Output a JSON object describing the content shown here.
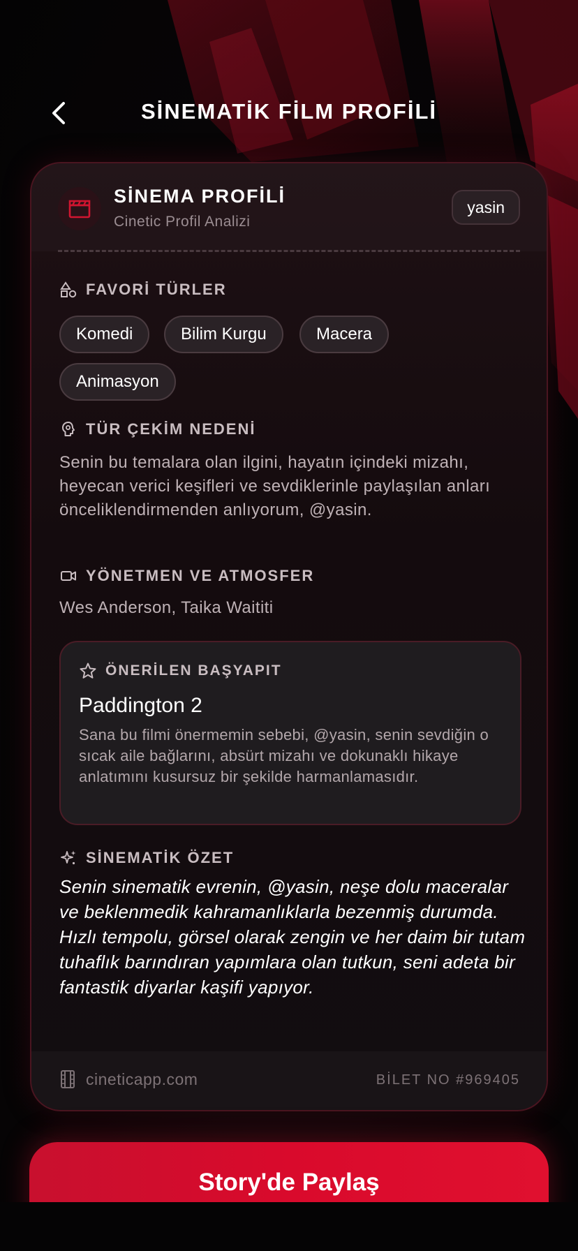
{
  "header": {
    "title": "SİNEMATİK FİLM PROFİLİ"
  },
  "card": {
    "title": "SİNEMA PROFİLİ",
    "subtitle": "Cinetic Profil Analizi",
    "username": "yasin"
  },
  "genres": {
    "heading": "FAVORİ TÜRLER",
    "items": [
      "Komedi",
      "Bilim Kurgu",
      "Macera",
      "Animasyon"
    ]
  },
  "reason": {
    "heading": "TÜR ÇEKİM NEDENİ",
    "text": "Senin bu temalara olan ilgini, hayatın içindeki mizahı, heyecan verici keşifleri ve sevdiklerinle paylaşılan anları önceliklendirmenden anlıyorum, @yasin."
  },
  "directors": {
    "heading": "YÖNETMEN VE ATMOSFER",
    "text": "Wes Anderson, Taika Waititi"
  },
  "masterpiece": {
    "heading": "ÖNERİLEN BAŞYAPIT",
    "title": "Paddington 2",
    "text": "Sana bu filmi önermemin sebebi, @yasin, senin sevdiğin o sıcak aile bağlarını, absürt mizahı ve dokunaklı hikaye anlatımını kusursuz bir şekilde harmanlamasıdır."
  },
  "summary": {
    "heading": "SİNEMATİK ÖZET",
    "text": "Senin sinematik evrenin, @yasin, neşe dolu maceralar ve beklenmedik kahramanlıklarla bezenmiş durumda. Hızlı tempolu, görsel olarak zengin ve her daim bir tutam tuhaflık barındıran yapımlara olan tutkun, seni adeta bir fantastik diyarlar kaşifi yapıyor."
  },
  "footer": {
    "site": "cineticapp.com",
    "ticket": "BİLET NO #969405"
  },
  "share_button": {
    "label": "Story'de Paylaş"
  },
  "colors": {
    "accent": "#d90a2c",
    "card_border": "#4a1520",
    "background": "#050405"
  },
  "icons": {
    "back": "chevron-left-icon",
    "clapper": "clapperboard-icon",
    "genres": "shapes-icon",
    "reason": "brain-icon",
    "directors": "video-camera-icon",
    "masterpiece": "star-icon",
    "summary": "sparkles-icon",
    "footer": "film-strip-icon"
  }
}
